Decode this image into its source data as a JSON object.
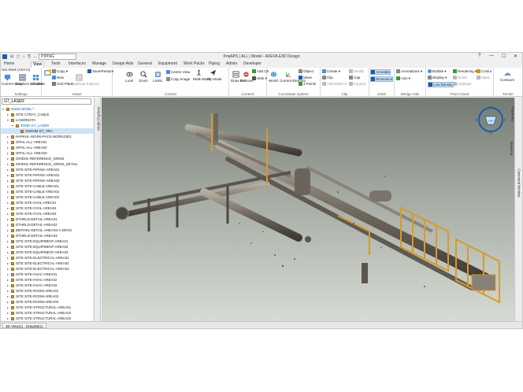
{
  "titlebar": {
    "qat": "⊞ ▢ ⌂ ⎘ ⌄",
    "dropdown_value": "PIPING",
    "title": "ProjAPS | ALL | Model - AVEVA E3D Design",
    "help": "?",
    "minimize": "—",
    "maximize": "☐",
    "close": "✕"
  },
  "tabs": [
    "Home",
    "View",
    "Tools",
    "Interfaces",
    "Manage",
    "Design Aids",
    "General",
    "Equipment",
    "Work Packs",
    "Piping",
    "Admin",
    "Developer"
  ],
  "active_tab": "View",
  "ribbon": {
    "settings": {
      "get_work": "Get Work (Ctrl+G)",
      "current_view": "Current View",
      "graphics_drawlist": "Graphics Drawlist",
      "all_views": "All Views",
      "label": "Settings"
    },
    "views": {
      "copy": "Copy",
      "new": "New",
      "grid_plane": "Grid Plane",
      "graphical_explorer": "Graphical Explorer",
      "save_restore": "Save/Restore",
      "label": "Views"
    },
    "control": {
      "look": "Look",
      "zoom": "Zoom",
      "limits": "Limits",
      "centre_view": "Centre View",
      "copy_image": "Copy Image",
      "walk_mode": "Walk Mode",
      "fly_mode": "Fly Mode",
      "label": "Control"
    },
    "content": {
      "draw_list": "Draw List",
      "remove": "Remove",
      "add_ce": "Add CE",
      "hide": "Hide",
      "label": "Content"
    },
    "coordinate_system": {
      "world": "World",
      "current_element": "Current Element",
      "object": "Object",
      "move": "Move",
      "three_points": "3 Points",
      "label": "Coordinate System"
    },
    "clip": {
      "create": "Create",
      "clip": "Clip",
      "add_within": "Add Within",
      "modify": "Modify",
      "cap": "Cap",
      "expand": "Expand",
      "label": "Clip"
    },
    "grids": {
      "annotate": "Annotate",
      "dimension": "Dimension",
      "label": "Grids"
    },
    "design_aids": {
      "annotations": "Annotations",
      "axis": "Axis",
      "label": "Design Aids"
    },
    "point_cloud": {
      "bubble": "Bubble",
      "display": "Display",
      "low_density": "Low Density",
      "rendering": "Rendering",
      "detail": "Detail",
      "highlight": "Highlight",
      "colour": "Colour",
      "mask": "Mask",
      "label": "Point Cloud"
    },
    "terrain": {
      "contours": "Contours",
      "label": "Terrain"
    }
  },
  "explorer": {
    "search_value": "G7_LASER",
    "side_tab": "Model Explorer",
    "nodes": [
      {
        "text": "Model WORL *",
        "depth": 0,
        "exp": "▾",
        "state": "open"
      },
      {
        "text": "SITE CTRAY_CABLE",
        "depth": 1,
        "exp": "▸",
        "state": ""
      },
      {
        "text": "LASERDATA",
        "depth": 1,
        "exp": "▾",
        "state": ""
      },
      {
        "text": "ZONE G7_LASER",
        "depth": 2,
        "exp": "▾",
        "state": "open"
      },
      {
        "text": "XGEOM G7_TRA",
        "depth": 3,
        "exp": "",
        "state": "sel"
      },
      {
        "text": "HAPKHL-WORK-PACK-WORLD001",
        "depth": 1,
        "exp": "▸",
        "state": ""
      },
      {
        "text": "GPHL-ALL-AREA01",
        "depth": 1,
        "exp": "▸",
        "state": ""
      },
      {
        "text": "GPHL-ALL-AREA02",
        "depth": 1,
        "exp": "▸",
        "state": ""
      },
      {
        "text": "GPHL-ALL-AREA03",
        "depth": 1,
        "exp": "▸",
        "state": ""
      },
      {
        "text": "GRIDHL-REFERENCE_GRIDS",
        "depth": 1,
        "exp": "▸",
        "state": ""
      },
      {
        "text": "GRIDHL-REFERENCE_GRIDS_DETAIL",
        "depth": 1,
        "exp": "▸",
        "state": ""
      },
      {
        "text": "SITE SITE-PIPING-AREA01",
        "depth": 1,
        "exp": "▸",
        "state": ""
      },
      {
        "text": "SITE SITE-PIPING-AREA02",
        "depth": 1,
        "exp": "▸",
        "state": ""
      },
      {
        "text": "SITE SITE-PIPING-AREA03",
        "depth": 1,
        "exp": "▸",
        "state": ""
      },
      {
        "text": "SITE SITE-CABLE-AREA01",
        "depth": 1,
        "exp": "▸",
        "state": ""
      },
      {
        "text": "SITE SITE-CABLE-AREA02",
        "depth": 1,
        "exp": "▸",
        "state": ""
      },
      {
        "text": "SITE SITE-CABLE-AREA03",
        "depth": 1,
        "exp": "▸",
        "state": ""
      },
      {
        "text": "SITE SITE-CIVIL-AREA01",
        "depth": 1,
        "exp": "▸",
        "state": ""
      },
      {
        "text": "SITE SITE-CIVIL-AREA02",
        "depth": 1,
        "exp": "▸",
        "state": ""
      },
      {
        "text": "SITE SITE-CIVIL-AREA03",
        "depth": 1,
        "exp": "▸",
        "state": ""
      },
      {
        "text": "DTHRLD-DETAIL-AREA01",
        "depth": 1,
        "exp": "▸",
        "state": ""
      },
      {
        "text": "DTHRLD-DETAIL-AREA02",
        "depth": 1,
        "exp": "▸",
        "state": ""
      },
      {
        "text": "BMTHRL-DETAIL-AREA03-A-DRVG",
        "depth": 1,
        "exp": "▸",
        "state": ""
      },
      {
        "text": "DTHRLD-DETAIL-AREA03",
        "depth": 1,
        "exp": "▸",
        "state": ""
      },
      {
        "text": "SITE SITE-EQUIPMENT-AREA01",
        "depth": 1,
        "exp": "▸",
        "state": ""
      },
      {
        "text": "SITE SITE-EQUIPMENT-AREA02",
        "depth": 1,
        "exp": "▸",
        "state": ""
      },
      {
        "text": "SITE SITE-EQUIPMENT-AREA03",
        "depth": 1,
        "exp": "▸",
        "state": ""
      },
      {
        "text": "SITE SITE-ELECTRICAL-AREA01",
        "depth": 1,
        "exp": "▸",
        "state": ""
      },
      {
        "text": "SITE SITE-ELECTRICAL-AREA02",
        "depth": 1,
        "exp": "▸",
        "state": ""
      },
      {
        "text": "SITE SITE-ELECTRICAL-AREA03",
        "depth": 1,
        "exp": "▸",
        "state": ""
      },
      {
        "text": "SITE SITE-HVAC-AREA01",
        "depth": 1,
        "exp": "▸",
        "state": ""
      },
      {
        "text": "SITE SITE-HVAC-AREA02",
        "depth": 1,
        "exp": "▸",
        "state": ""
      },
      {
        "text": "SITE SITE-HVAC-AREA03",
        "depth": 1,
        "exp": "▸",
        "state": ""
      },
      {
        "text": "SITE SITE-ROOM-AREA01",
        "depth": 1,
        "exp": "▸",
        "state": ""
      },
      {
        "text": "SITE SITE-ROOM-AREA02",
        "depth": 1,
        "exp": "▸",
        "state": ""
      },
      {
        "text": "SITE SITE-ROOM-AREA03",
        "depth": 1,
        "exp": "▸",
        "state": ""
      },
      {
        "text": "SITE SITE-STRUCTURAL-AREA01",
        "depth": 1,
        "exp": "▸",
        "state": ""
      },
      {
        "text": "SITE SITE-STRUCTURAL-AREA02",
        "depth": 1,
        "exp": "▸",
        "state": ""
      },
      {
        "text": "SITE SITE-STRUCTURAL-AREA03",
        "depth": 1,
        "exp": "▸",
        "state": ""
      }
    ]
  },
  "viewcube": {
    "north": "N",
    "south": "S",
    "east": "E",
    "west": "W",
    "top": "TOP"
  },
  "right_panel": [
    "Properties",
    "Modeling",
    "Command Window"
  ],
  "bottom_tab": "3D View(1) - Drawlist(1)",
  "colors": {
    "accent": "#1f5aa6",
    "pipe": "#8e8679",
    "steel": "#d89a2b"
  }
}
